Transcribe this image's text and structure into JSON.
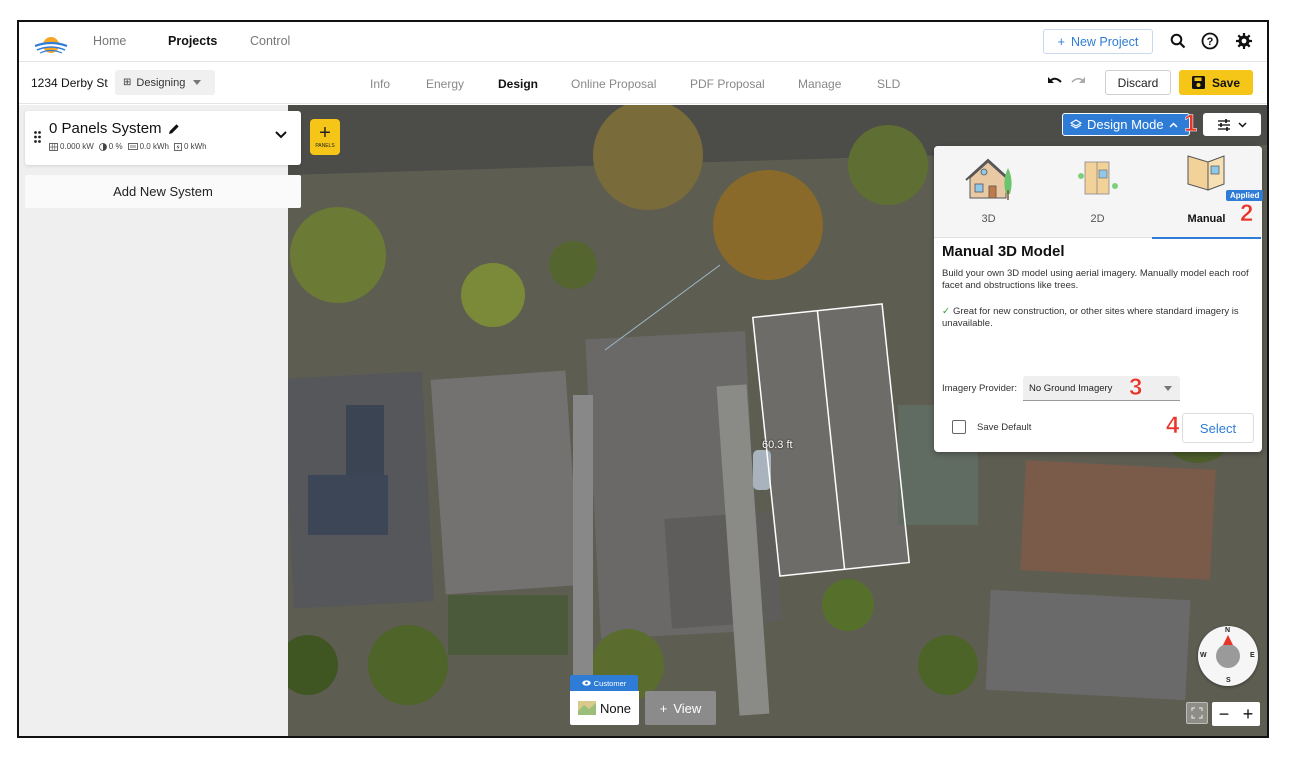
{
  "nav": {
    "links": [
      "Home",
      "Projects",
      "Control"
    ],
    "new_project": "New Project"
  },
  "project": {
    "address": "1234 Derby St",
    "status": "Designing",
    "tabs": [
      "Info",
      "Energy",
      "Design",
      "Online Proposal",
      "PDF Proposal",
      "Manage",
      "SLD"
    ],
    "discard": "Discard",
    "save": "Save"
  },
  "sidebar": {
    "system_title": "0 Panels System",
    "stats": {
      "capacity": "0.000 kW",
      "offset": "0 %",
      "production": "0.0 kWh",
      "battery": "0 kWh"
    },
    "add_system": "Add New System"
  },
  "map": {
    "panels_button": "PANELS",
    "design_mode": "Design Mode",
    "measurement": "60.3 ft",
    "customer_tag": "Customer",
    "view_none": "None",
    "view_add": "View",
    "compass": {
      "n": "N",
      "s": "S",
      "e": "E",
      "w": "W"
    }
  },
  "callouts": [
    "1",
    "2",
    "3",
    "4"
  ],
  "model_panel": {
    "tabs": [
      "3D",
      "2D",
      "Manual"
    ],
    "applied_badge": "Applied",
    "title": "Manual 3D Model",
    "description": "Build your own 3D model using aerial imagery. Manually model each roof facet and obstructions like trees.",
    "note": "Great for new construction, or other sites where standard imagery is unavailable.",
    "provider_label": "Imagery Provider:",
    "provider_value": "No Ground Imagery",
    "save_default": "Save Default",
    "select_button": "Select"
  },
  "colors": {
    "accent_blue": "#2e7cd6",
    "save_yellow": "#f5c518",
    "callout_red": "#e8352a"
  }
}
